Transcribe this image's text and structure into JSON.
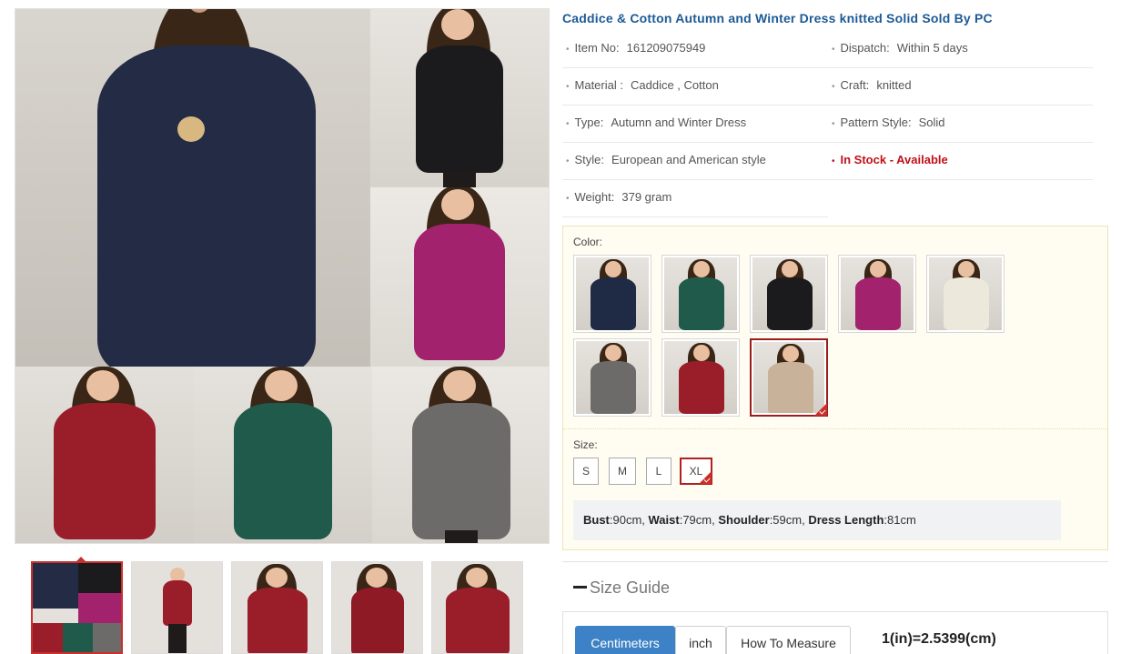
{
  "product": {
    "title": "Caddice & Cotton Autumn and Winter Dress knitted Solid Sold By PC"
  },
  "specs": [
    {
      "left": {
        "key": "Item No:",
        "value": "161209075949"
      },
      "right": {
        "key": "Dispatch:",
        "value": "Within 5 days"
      }
    },
    {
      "left": {
        "key": "Material :",
        "value": "Caddice , Cotton"
      },
      "right": {
        "key": "Craft:",
        "value": "knitted"
      }
    },
    {
      "left": {
        "key": "Type:",
        "value": "Autumn and Winter Dress"
      },
      "right": {
        "key": "Pattern Style:",
        "value": "Solid"
      }
    },
    {
      "left": {
        "key": "Style:",
        "value": "European and American style"
      },
      "right": {
        "key": "",
        "value": "In Stock - Available"
      }
    },
    {
      "left": {
        "key": "Weight:",
        "value": "379 gram"
      }
    }
  ],
  "options": {
    "color_label": "Color:",
    "colors": [
      {
        "name": "navy",
        "hex": "#1f2a44"
      },
      {
        "name": "green",
        "hex": "#1f5a4a"
      },
      {
        "name": "black",
        "hex": "#1b1b1d"
      },
      {
        "name": "magenta",
        "hex": "#a3226d"
      },
      {
        "name": "white",
        "hex": "#ece8dc"
      },
      {
        "name": "gray",
        "hex": "#6d6b69"
      },
      {
        "name": "red",
        "hex": "#9a1d2a"
      },
      {
        "name": "khaki",
        "hex": "#c8b29a",
        "selected": true
      }
    ],
    "size_label": "Size:",
    "sizes": [
      {
        "label": "S"
      },
      {
        "label": "M"
      },
      {
        "label": "L"
      },
      {
        "label": "XL",
        "selected": true
      }
    ],
    "measurements": [
      {
        "name": "Bust",
        "value": ":90cm, "
      },
      {
        "name": "Waist",
        "value": ":79cm, "
      },
      {
        "name": "Shoulder",
        "value": ":59cm, "
      },
      {
        "name": "Dress Length",
        "value": ":81cm"
      }
    ]
  },
  "size_guide": {
    "title": "Size Guide",
    "tabs": [
      {
        "label": "Centimeters",
        "active": true
      },
      {
        "label": "inch"
      },
      {
        "label": "How To Measure"
      }
    ],
    "conversion": "1(in)=2.5399(cm)"
  },
  "theme": {
    "title_color": "#1d5a96",
    "stock_color": "#c0101a",
    "selected_border": "#9b1d1d",
    "tab_active": "#3d82c6"
  }
}
